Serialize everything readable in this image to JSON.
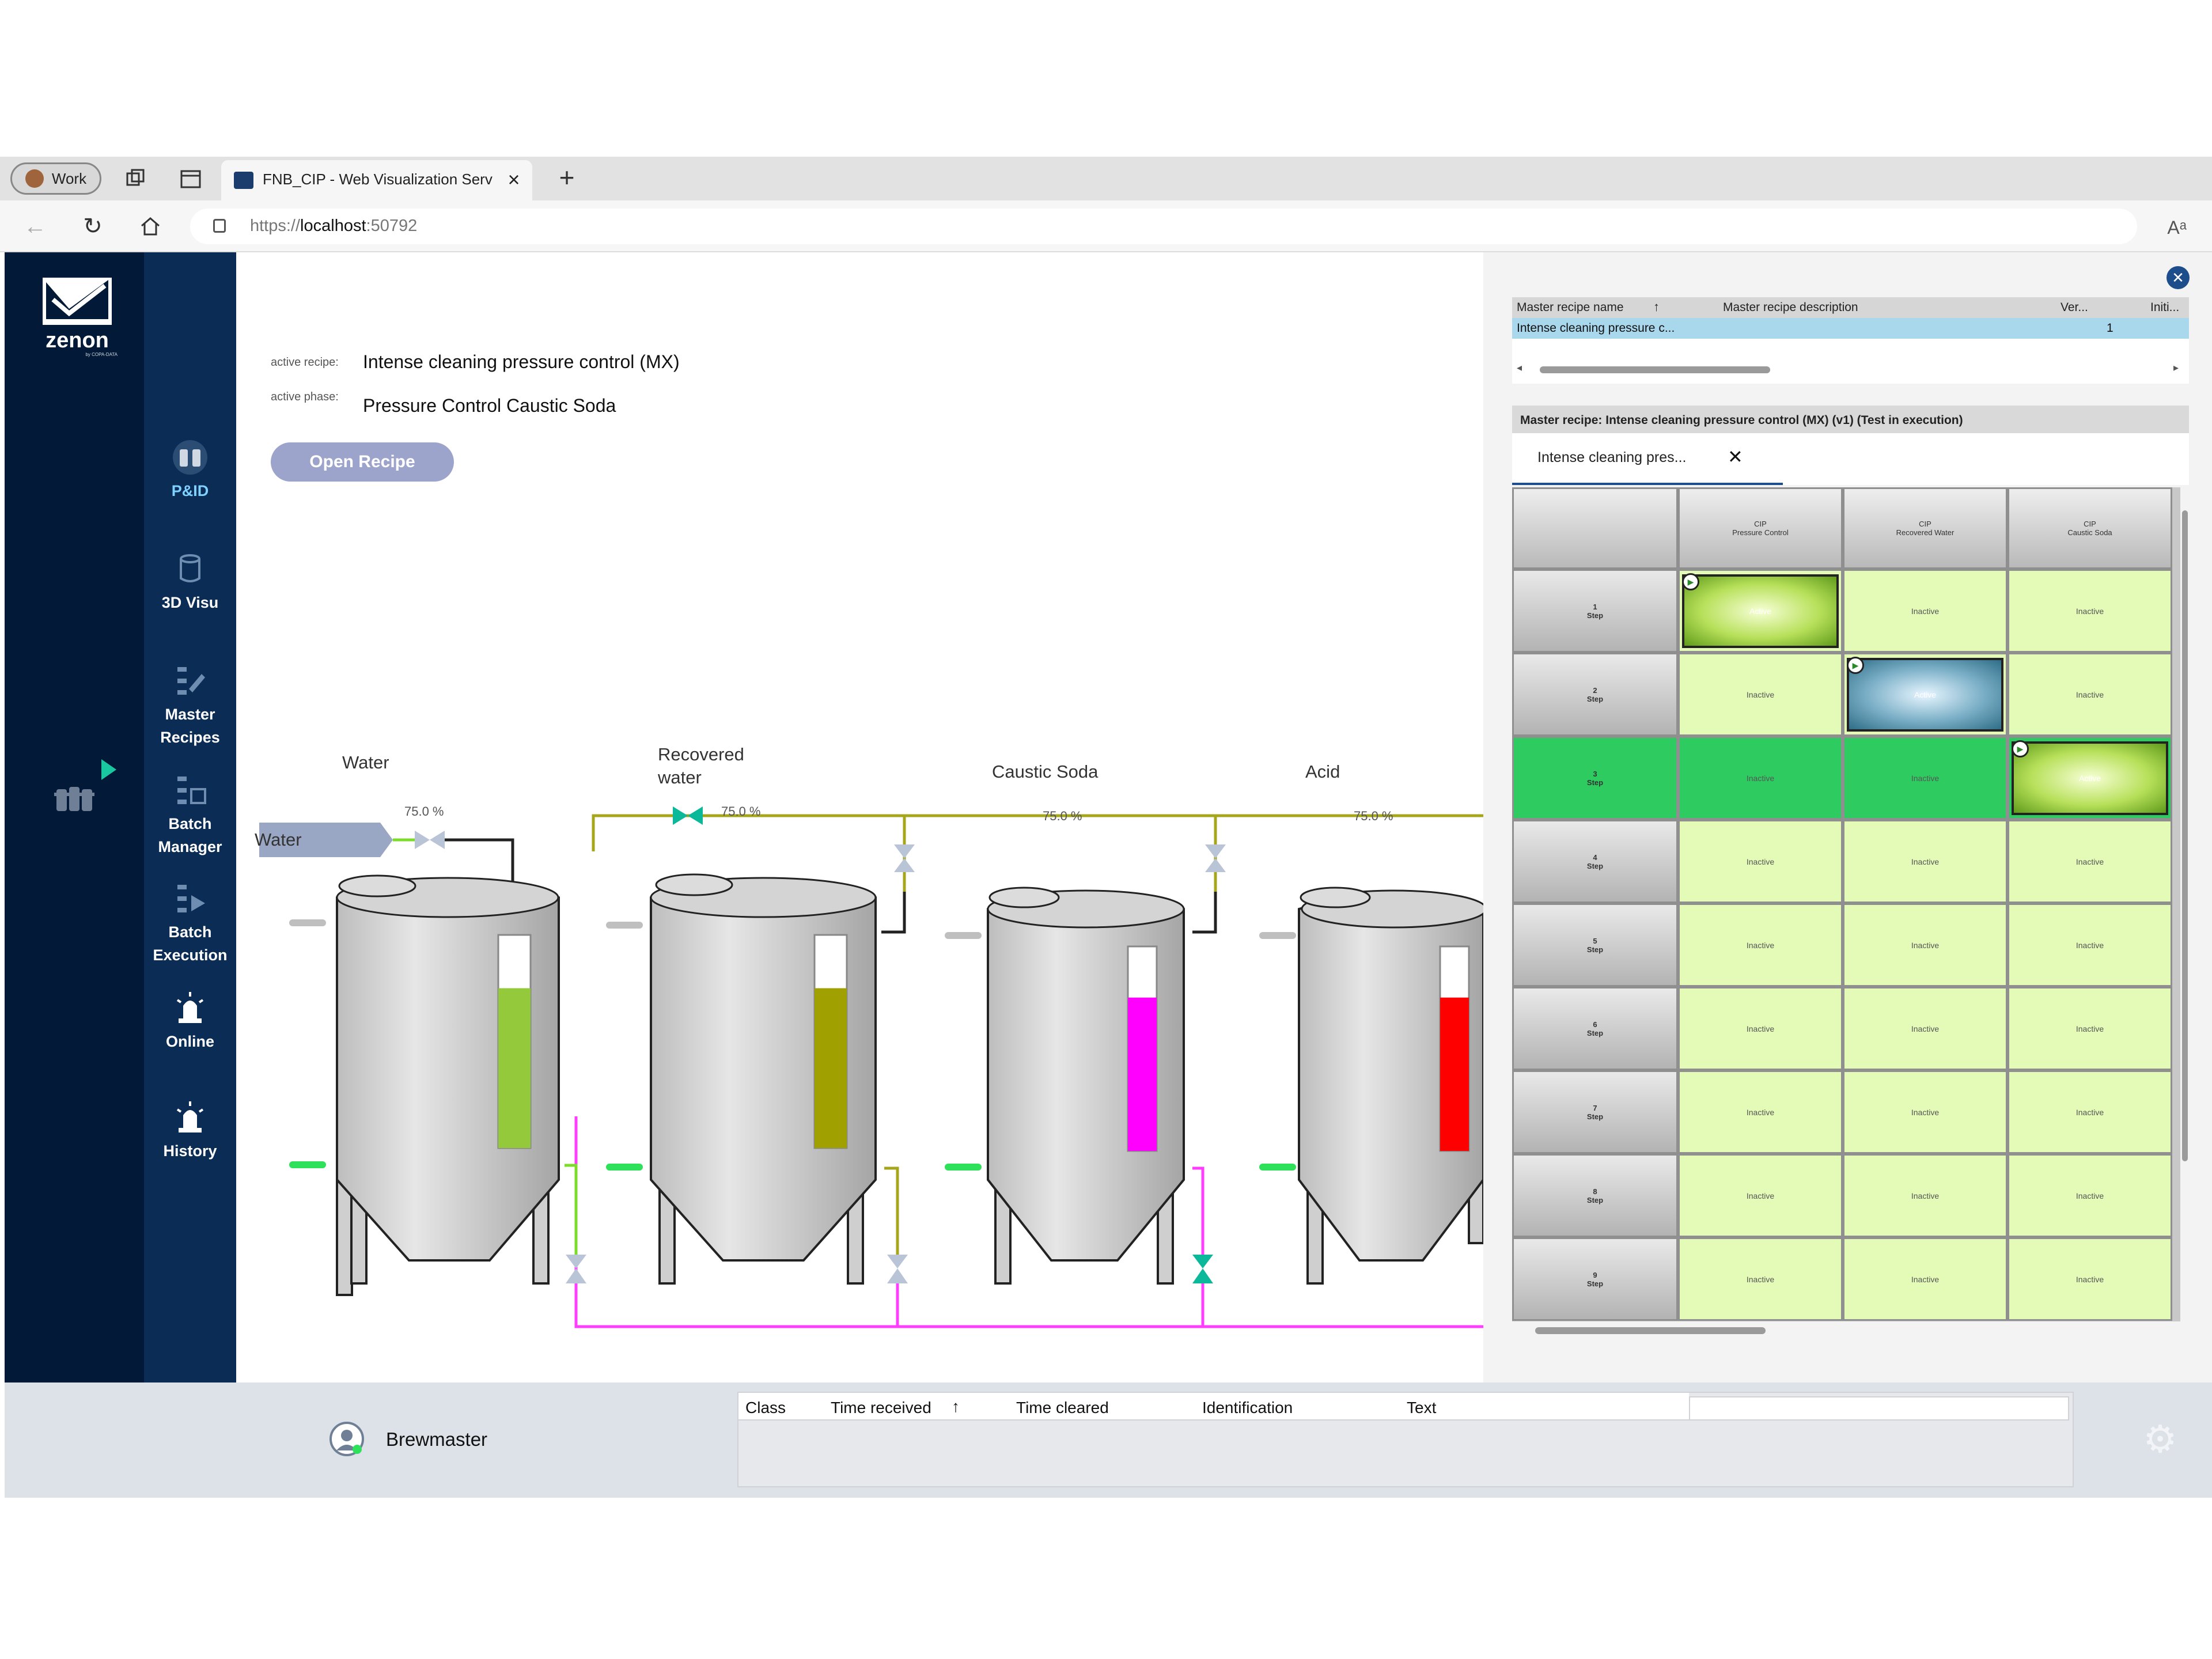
{
  "browser": {
    "profile_label": "Work",
    "tab_title": "FNB_CIP - Web Visualization Serv",
    "new_tab": "+",
    "close_tab": "×",
    "url_prefix": "https://",
    "url_host": "localhost",
    "url_port": ":50792"
  },
  "app": {
    "logo_text": "zenon",
    "logo_sub": "by COPA-DATA"
  },
  "nav": {
    "items": [
      {
        "label": "P&ID",
        "icon": "pid-icon",
        "active": true
      },
      {
        "label": "3D Visu",
        "icon": "3d-visu-icon"
      },
      {
        "label": "Master Recipes",
        "icon": "master-recipes-icon"
      },
      {
        "label": "Batch Manager",
        "icon": "batch-manager-icon"
      },
      {
        "label": "Batch Execution",
        "icon": "batch-execution-icon"
      },
      {
        "label": "Online",
        "icon": "alarm-online-icon"
      },
      {
        "label": "History",
        "icon": "alarm-history-icon"
      }
    ]
  },
  "recipe_info": {
    "active_recipe_label": "active recipe:",
    "active_recipe_value": "Intense cleaning pressure control (MX)",
    "active_phase_label": "active phase:",
    "active_phase_value": "Pressure Control Caustic Soda",
    "open_button": "Open Recipe"
  },
  "pid": {
    "source_label": "Water",
    "tanks": [
      {
        "name": "Water",
        "level_text": "75.0 %",
        "level": 0.75,
        "color": "#94c93c"
      },
      {
        "name": "Recovered\nwater",
        "level_text": "75.0 %",
        "level": 0.75,
        "color": "#a0a000"
      },
      {
        "name": "Caustic Soda",
        "level_text": "75.0 %",
        "level": 0.75,
        "color": "#ff00ff"
      },
      {
        "name": "Acid",
        "level_text": "75.0 %",
        "level": 0.75,
        "color": "#ff0000"
      }
    ]
  },
  "recipe_table": {
    "columns": [
      "Master recipe name",
      "Master recipe description",
      "Ver...",
      "Initi..."
    ],
    "row": {
      "name": "Intense cleaning pressure c...",
      "description": "",
      "version": "1",
      "initial": ""
    }
  },
  "recipe_editor": {
    "title": "Master recipe: Intense cleaning pressure control (MX) (v1) (Test in execution)",
    "tab_label": "Intense cleaning pres...",
    "tab_close": "✕",
    "column_headers": [
      "CIP\nPressure Control",
      "CIP\nRecovered Water",
      "CIP\nCaustic Soda"
    ],
    "rows": [
      {
        "label": "1\nStep",
        "cells": [
          "Active",
          "Inactive",
          "Inactive"
        ]
      },
      {
        "label": "2\nStep",
        "cells": [
          "Inactive",
          "Active",
          "Inactive"
        ]
      },
      {
        "label": "3\nStep",
        "cells": [
          "Inactive",
          "Inactive",
          "Active"
        ],
        "highlight": true
      },
      {
        "label": "4\nStep",
        "cells": [
          "Inactive",
          "Inactive",
          "Inactive"
        ]
      },
      {
        "label": "5\nStep",
        "cells": [
          "Inactive",
          "Inactive",
          "Inactive"
        ]
      },
      {
        "label": "6\nStep",
        "cells": [
          "Inactive",
          "Inactive",
          "Inactive"
        ]
      },
      {
        "label": "7\nStep",
        "cells": [
          "Inactive",
          "Inactive",
          "Inactive"
        ]
      },
      {
        "label": "8\nStep",
        "cells": [
          "Inactive",
          "Inactive",
          "Inactive"
        ]
      },
      {
        "label": "9\nStep",
        "cells": [
          "Inactive",
          "Inactive",
          "Inactive"
        ]
      }
    ]
  },
  "alarm_list": {
    "columns": [
      "Class",
      "Time received",
      "Time cleared",
      "Identification",
      "Text"
    ]
  },
  "user": {
    "name": "Brewmaster"
  },
  "colors": {
    "sidebar_dark": "#021a37",
    "sidebar": "#0a2c55",
    "active_step": "#2ecc60",
    "inactive_cell": "#e4fbb8",
    "pipe_yellow": "#a6a61a",
    "pipe_magenta": "#ff3cff",
    "valve_teal": "#0bb89a"
  }
}
